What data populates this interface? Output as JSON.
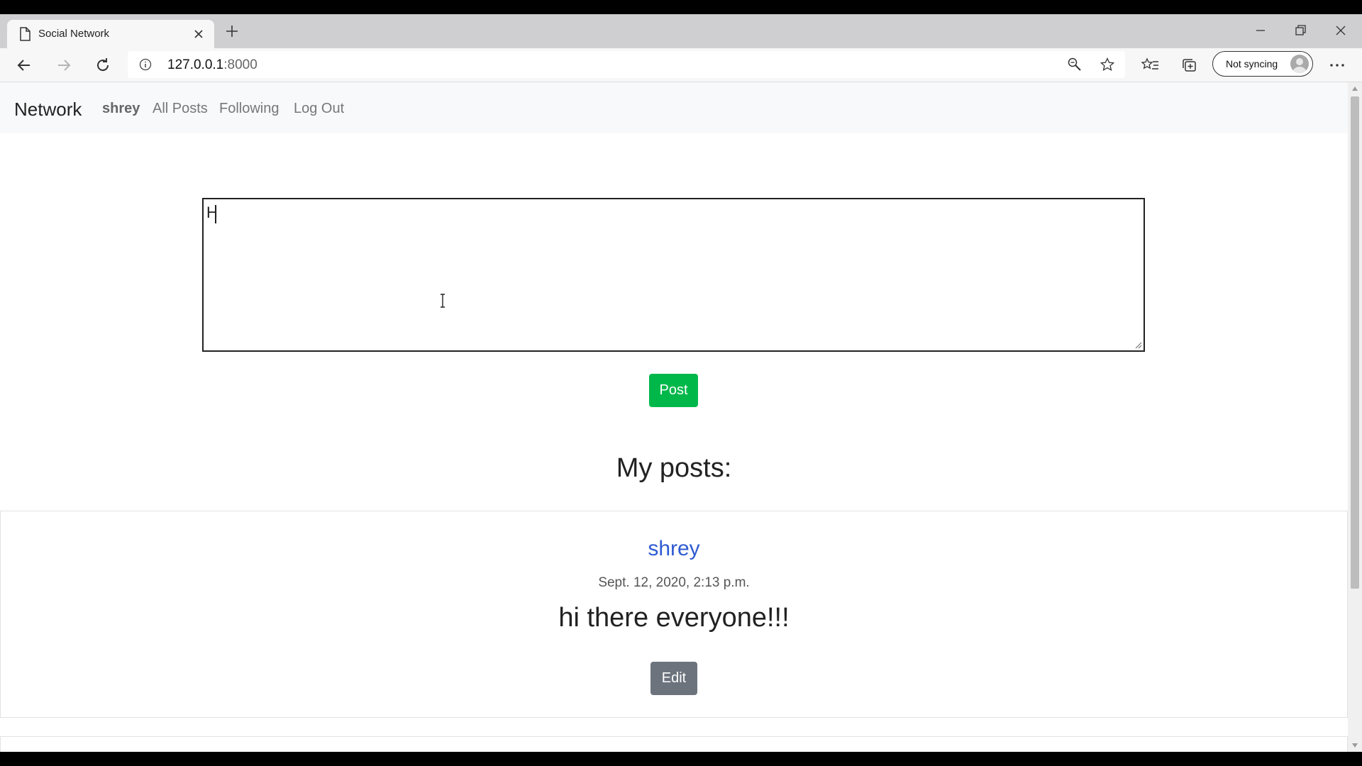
{
  "browser": {
    "tab_title": "Social Network",
    "address": {
      "host": "127.0.0.1",
      "port": ":8000"
    },
    "sync_label": "Not syncing"
  },
  "navbar": {
    "brand": "Network",
    "username": "shrey",
    "links": [
      "All Posts",
      "Following",
      "Log Out"
    ]
  },
  "composer": {
    "value": "H",
    "button_label": "Post"
  },
  "section_title": "My posts:",
  "posts": [
    {
      "user": "shrey",
      "timestamp": "Sept. 12, 2020, 2:13 p.m.",
      "content": "hi there everyone!!!",
      "edit_label": "Edit"
    }
  ],
  "colors": {
    "post_button": "#00b84a",
    "edit_button": "#6c737c",
    "username_link": "#2f5bd2"
  }
}
